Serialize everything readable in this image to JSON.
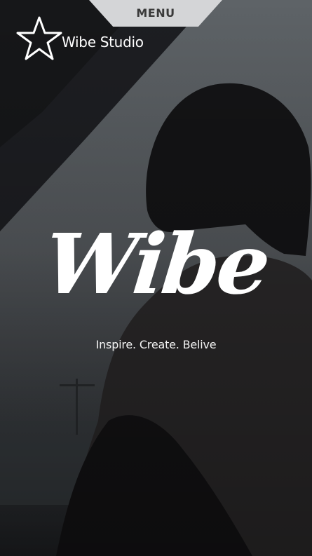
{
  "nav": {
    "menu_label": "MENU"
  },
  "brand": {
    "name": "Wibe Studio",
    "logo_icon": "star-outline-icon"
  },
  "hero": {
    "headline": "Wibe",
    "tagline": "Inspire. Create. Belive",
    "background_image": "woman-silhouette-photo"
  },
  "colors": {
    "menu_tab": "#d4d5d7",
    "menu_text": "#3a3a3a",
    "text": "#ffffff"
  }
}
